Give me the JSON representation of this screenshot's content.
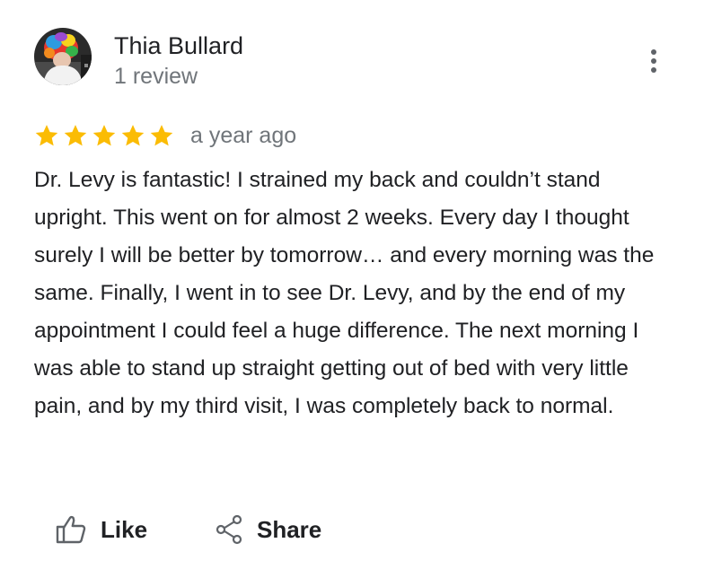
{
  "reviewer": {
    "name": "Thia Bullard",
    "review_count": "1 review",
    "avatar_icon": "profile-photo"
  },
  "review": {
    "rating": 5,
    "rating_max": 5,
    "star_color": "#fbbc04",
    "time": "a year ago",
    "text": "Dr. Levy is fantastic! I strained my back and couldn’t stand upright. This went on for almost 2 weeks. Every day I thought surely I will be better by tomorrow… and every morning was the same. Finally, I went in to see Dr. Levy, and by the end of my appointment I could feel a huge difference. The next morning I was able to stand up straight getting out of bed with very little pain, and by my third visit, I was completely back to normal."
  },
  "actions": {
    "like_label": "Like",
    "like_icon": "thumbs-up-icon",
    "share_label": "Share",
    "share_icon": "share-icon",
    "more_icon": "more-vert-icon"
  },
  "colors": {
    "text_primary": "#202124",
    "text_secondary": "#70757a",
    "icon_gray": "#5f6368"
  }
}
